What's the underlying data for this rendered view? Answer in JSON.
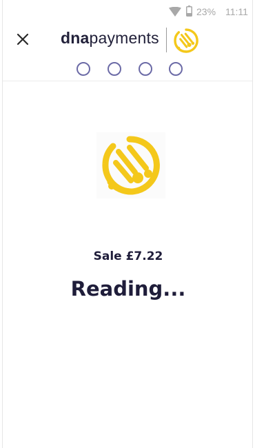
{
  "status_bar": {
    "battery_percent": "23%",
    "time": "11:11",
    "icons": [
      "wifi-icon",
      "battery-icon"
    ]
  },
  "header": {
    "close_icon": "close-icon",
    "brand": {
      "bold_part": "dna",
      "light_part": "payments",
      "mark_icon": "dna-mark-icon"
    },
    "steps": [
      {
        "state": "empty"
      },
      {
        "state": "empty"
      },
      {
        "state": "empty"
      },
      {
        "state": "empty"
      }
    ]
  },
  "main": {
    "logo_icon": "dna-mark-icon",
    "sale_label": "Sale £7.22",
    "status_label": "Reading..."
  },
  "colors": {
    "brand_yellow": "#f4c81b",
    "step_ring": "#6b6aa6",
    "text_dark": "#1f1d3a",
    "status_grey": "#a8a8a8"
  }
}
